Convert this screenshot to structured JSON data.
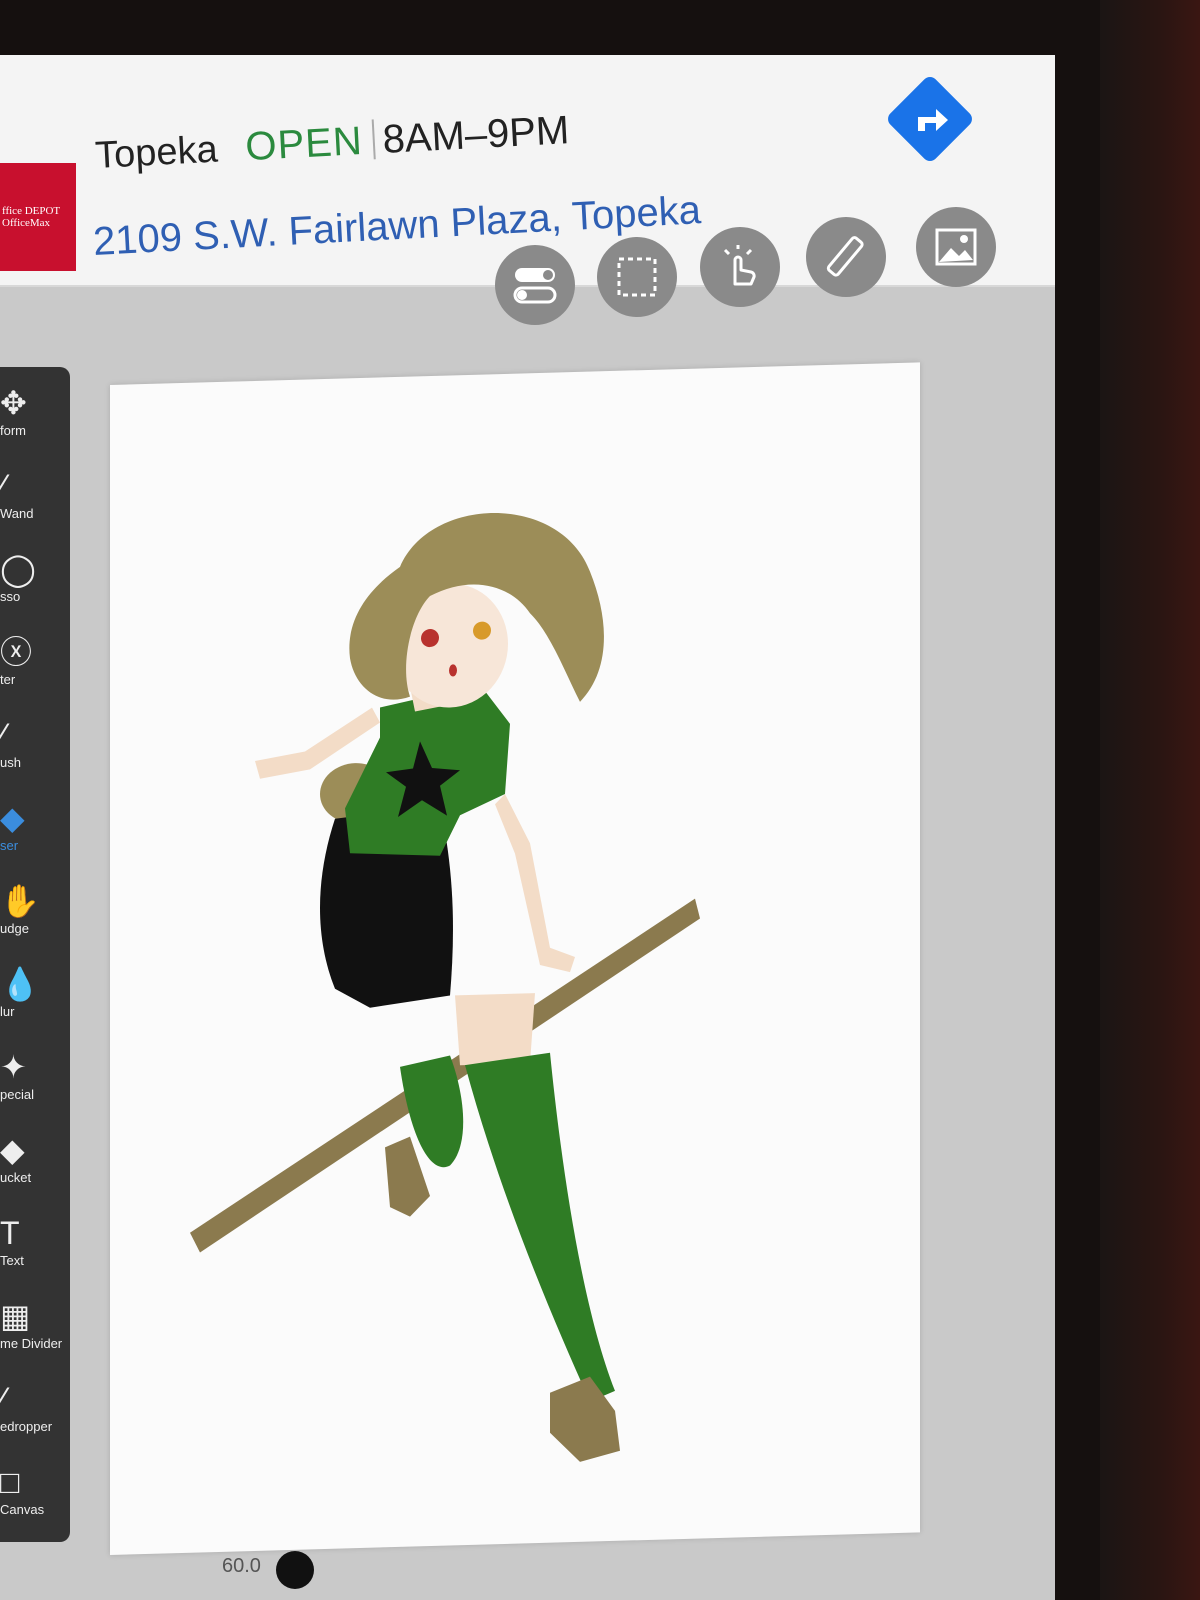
{
  "location_banner": {
    "store_logo_line1": "ffice DEPOT",
    "store_logo_line2": "OfficeMax",
    "store_name": "Topeka",
    "status": "OPEN",
    "hours": "8AM–9PM",
    "address": "2109 S.W. Fairlawn Plaza, Topeka",
    "directions_icon": "directions-arrow-icon"
  },
  "top_toolbar": [
    {
      "name": "toggle-icon"
    },
    {
      "name": "selection-icon"
    },
    {
      "name": "hand-touch-icon"
    },
    {
      "name": "ruler-icon"
    },
    {
      "name": "image-icon"
    }
  ],
  "tools": [
    {
      "label": "form",
      "icon": "transform-icon"
    },
    {
      "label": "Wand",
      "icon": "magic-wand-icon"
    },
    {
      "label": "sso",
      "icon": "lasso-icon"
    },
    {
      "label": "ter",
      "icon": "filter-icon"
    },
    {
      "label": "ush",
      "icon": "brush-icon"
    },
    {
      "label": "ser",
      "icon": "eraser-icon",
      "active": true
    },
    {
      "label": "udge",
      "icon": "smudge-icon"
    },
    {
      "label": "lur",
      "icon": "blur-icon"
    },
    {
      "label": "pecial",
      "icon": "special-icon"
    },
    {
      "label": "ucket",
      "icon": "bucket-icon"
    },
    {
      "label": "Text",
      "icon": "text-icon"
    },
    {
      "label": "me Divider",
      "icon": "frame-divider-icon"
    },
    {
      "label": "edropper",
      "icon": "eyedropper-icon"
    },
    {
      "label": "Canvas",
      "icon": "canvas-icon"
    }
  ],
  "status_bar": {
    "zoom": "60.0"
  },
  "colors": {
    "accent": "#1a73e8",
    "open_status": "#2b8a3e",
    "address": "#2f5fb3",
    "active_tool": "#3b8dde"
  }
}
